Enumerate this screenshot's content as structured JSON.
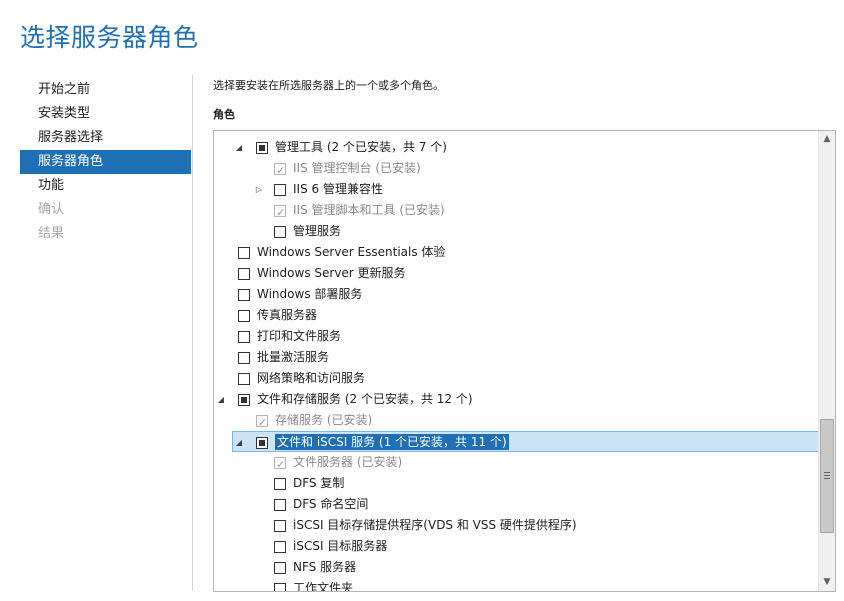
{
  "page_title": "选择服务器角色",
  "nav": {
    "items": [
      {
        "label": "开始之前",
        "state": "normal"
      },
      {
        "label": "安装类型",
        "state": "normal"
      },
      {
        "label": "服务器选择",
        "state": "normal"
      },
      {
        "label": "服务器角色",
        "state": "active"
      },
      {
        "label": "功能",
        "state": "normal"
      },
      {
        "label": "确认",
        "state": "disabled"
      },
      {
        "label": "结果",
        "state": "disabled"
      }
    ]
  },
  "description": "选择要安装在所选服务器上的一个或多个角色。",
  "roles_label": "角色",
  "roles": [
    {
      "label": "管理工具 (2 个已安装，共 7 个)",
      "level": 1,
      "expander": "expanded",
      "check": "partial"
    },
    {
      "label": "IIS 管理控制台 (已安装)",
      "level": 2,
      "expander": "none",
      "check": "checked-disabled"
    },
    {
      "label": "IIS 6 管理兼容性",
      "level": 2,
      "expander": "collapsed",
      "check": "unchecked"
    },
    {
      "label": "IIS 管理脚本和工具 (已安装)",
      "level": 2,
      "expander": "none",
      "check": "checked-disabled"
    },
    {
      "label": "管理服务",
      "level": 2,
      "expander": "none",
      "check": "unchecked"
    },
    {
      "label": "Windows Server Essentials 体验",
      "level": 0,
      "expander": "none",
      "check": "unchecked"
    },
    {
      "label": "Windows Server 更新服务",
      "level": 0,
      "expander": "none",
      "check": "unchecked"
    },
    {
      "label": "Windows 部署服务",
      "level": 0,
      "expander": "none",
      "check": "unchecked"
    },
    {
      "label": "传真服务器",
      "level": 0,
      "expander": "none",
      "check": "unchecked"
    },
    {
      "label": "打印和文件服务",
      "level": 0,
      "expander": "none",
      "check": "unchecked"
    },
    {
      "label": "批量激活服务",
      "level": 0,
      "expander": "none",
      "check": "unchecked"
    },
    {
      "label": "网络策略和访问服务",
      "level": 0,
      "expander": "none",
      "check": "unchecked"
    },
    {
      "label": "文件和存储服务 (2 个已安装，共 12 个)",
      "level": 0,
      "expander": "expanded",
      "check": "partial"
    },
    {
      "label": "存储服务 (已安装)",
      "level": 1,
      "expander": "none",
      "check": "checked-disabled"
    },
    {
      "label": "文件和 iSCSI 服务 (1 个已安装，共 11 个)",
      "level": 1,
      "expander": "expanded",
      "check": "partial",
      "selected": true
    },
    {
      "label": "文件服务器 (已安装)",
      "level": 2,
      "expander": "none",
      "check": "checked-disabled"
    },
    {
      "label": "DFS 复制",
      "level": 2,
      "expander": "none",
      "check": "unchecked"
    },
    {
      "label": "DFS 命名空间",
      "level": 2,
      "expander": "none",
      "check": "unchecked"
    },
    {
      "label": "iSCSI 目标存储提供程序(VDS 和 VSS 硬件提供程序)",
      "level": 2,
      "expander": "none",
      "check": "unchecked"
    },
    {
      "label": "iSCSI 目标服务器",
      "level": 2,
      "expander": "none",
      "check": "unchecked"
    },
    {
      "label": "NFS 服务器",
      "level": 2,
      "expander": "none",
      "check": "unchecked"
    },
    {
      "label": "工作文件夹",
      "level": 2,
      "expander": "none",
      "check": "unchecked"
    }
  ],
  "scrollbar": {
    "up_icon": "▲",
    "down_icon": "▼"
  },
  "colors": {
    "accent": "#1f6fb5",
    "selection": "#cce4f7"
  }
}
